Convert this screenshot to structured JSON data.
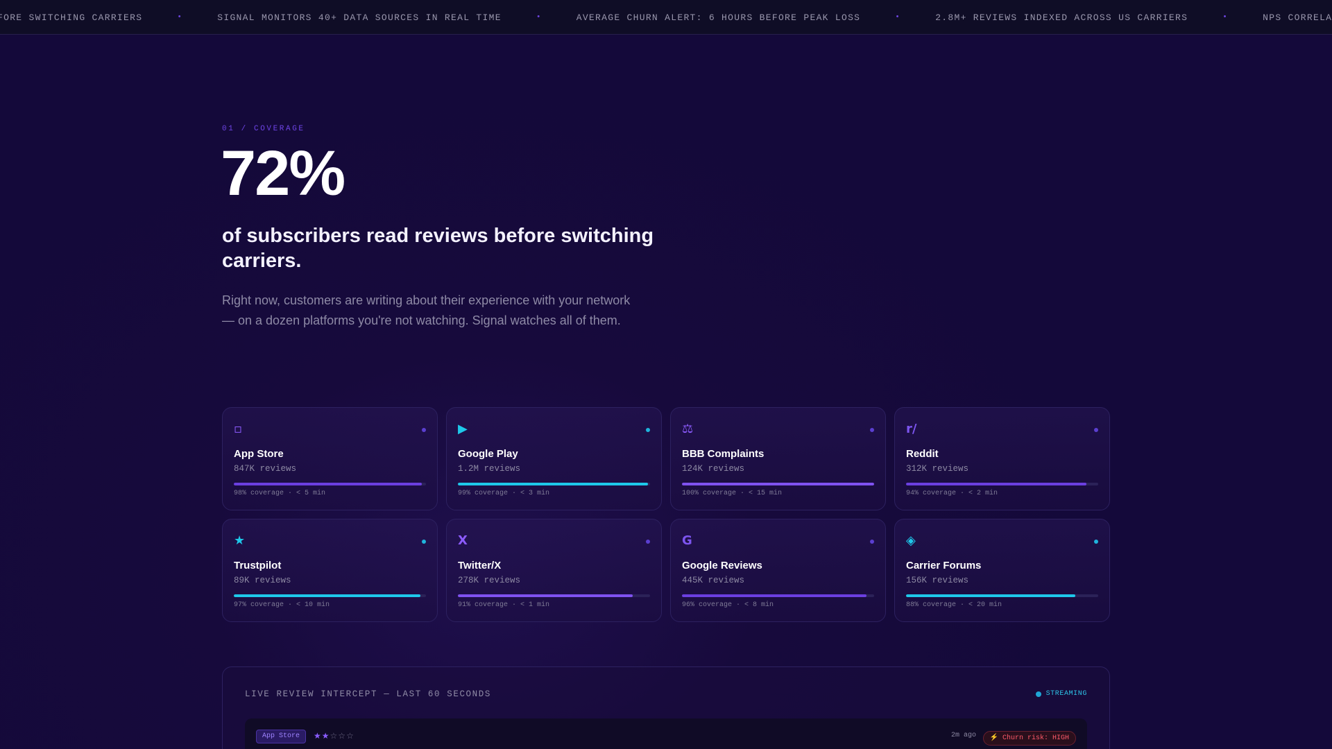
{
  "ticker": {
    "items": [
      "FORE SWITCHING CARRIERS",
      "SIGNAL MONITORS 40+ DATA SOURCES IN REAL TIME",
      "AVERAGE CHURN ALERT: 6 HOURS BEFORE PEAK LOSS",
      "2.8M+ REVIEWS INDEXED ACROSS US CARRIERS",
      "NPS CORRELATION ACCURACY:"
    ],
    "separator": "•"
  },
  "hero": {
    "eyebrow": "01 / COVERAGE",
    "stat": "72%",
    "headline": "of subscribers read reviews before switching carriers.",
    "lede": "Right now, customers are writing about their experience with your network — on a dozen platforms you're not watching. Signal watches all of them."
  },
  "colors": {
    "purple": "#6b3fe0",
    "cyan": "#1ec8ea",
    "violet": "#7f52f0"
  },
  "sources": [
    {
      "icon": "▫",
      "icon_name": "app-store-icon",
      "icon_color": "#8d5cff",
      "dot_color": "#5b3fd0",
      "title": "App Store",
      "count": "847K reviews",
      "coverage": 0.98,
      "bar_color": "#6b3fe0",
      "meta": "98% coverage · < 5 min"
    },
    {
      "icon": "▶",
      "icon_name": "google-play-icon",
      "icon_color": "#1ec8ea",
      "dot_color": "#1fb4dc",
      "title": "Google Play",
      "count": "1.2M reviews",
      "coverage": 0.99,
      "bar_color": "#1ec8ea",
      "meta": "99% coverage · < 3 min"
    },
    {
      "icon": "⚖",
      "icon_name": "bbb-scale-icon",
      "icon_color": "#8d5cff",
      "dot_color": "#5b3fd0",
      "title": "BBB Complaints",
      "count": "124K reviews",
      "coverage": 1.0,
      "bar_color": "#7f52f0",
      "meta": "100% coverage · < 15 min"
    },
    {
      "icon": "r/",
      "icon_name": "reddit-icon",
      "icon_color": "#7d55f0",
      "dot_color": "#5b3fd0",
      "title": "Reddit",
      "count": "312K reviews",
      "coverage": 0.94,
      "bar_color": "#6b3fe0",
      "meta": "94% coverage · < 2 min"
    },
    {
      "icon": "★",
      "icon_name": "trustpilot-star-icon",
      "icon_color": "#1ec8ea",
      "dot_color": "#1fb4dc",
      "title": "Trustpilot",
      "count": "89K reviews",
      "coverage": 0.97,
      "bar_color": "#1ec8ea",
      "meta": "97% coverage · < 10 min"
    },
    {
      "icon": "X",
      "icon_name": "twitter-x-icon",
      "icon_color": "#8d5cff",
      "dot_color": "#5b3fd0",
      "title": "Twitter/X",
      "count": "278K reviews",
      "coverage": 0.91,
      "bar_color": "#7f52f0",
      "meta": "91% coverage · < 1 min"
    },
    {
      "icon": "G",
      "icon_name": "google-reviews-icon",
      "icon_color": "#7d55f0",
      "dot_color": "#5b3fd0",
      "title": "Google Reviews",
      "count": "445K reviews",
      "coverage": 0.96,
      "bar_color": "#6b3fe0",
      "meta": "96% coverage · < 8 min"
    },
    {
      "icon": "◈",
      "icon_name": "carrier-forums-icon",
      "icon_color": "#1ec8ea",
      "dot_color": "#1fb4dc",
      "title": "Carrier Forums",
      "count": "156K reviews",
      "coverage": 0.88,
      "bar_color": "#1ec8ea",
      "meta": "88% coverage · < 20 min"
    }
  ],
  "live": {
    "title": "LIVE REVIEW INTERCEPT — LAST 60 SECONDS",
    "status": "STREAMING",
    "review": {
      "source": "App Store",
      "rating": 2,
      "rating_max": 5,
      "time": "2m ago",
      "risk": "⚡ Churn risk: HIGH"
    }
  }
}
